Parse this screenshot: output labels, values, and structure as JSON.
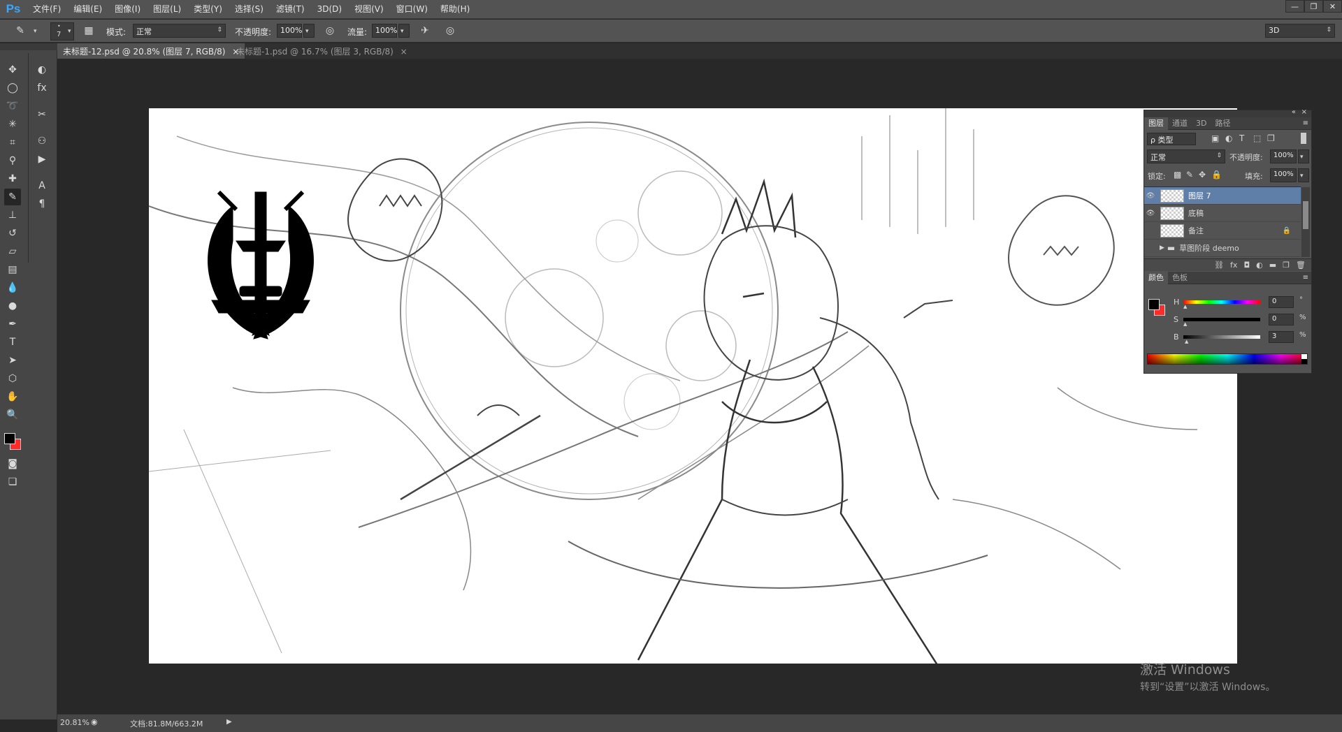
{
  "app": {
    "logo": "Ps"
  },
  "menu": [
    "文件(F)",
    "编辑(E)",
    "图像(I)",
    "图层(L)",
    "类型(Y)",
    "选择(S)",
    "滤镜(T)",
    "3D(D)",
    "视图(V)",
    "窗口(W)",
    "帮助(H)"
  ],
  "window_buttons": [
    "—",
    "❐",
    "✕"
  ],
  "options": {
    "brush_size": "7",
    "mode_label": "模式:",
    "mode_value": "正常",
    "opacity_label": "不透明度:",
    "opacity_value": "100%",
    "flow_label": "流量:",
    "flow_value": "100%",
    "workspace": "3D"
  },
  "tabs": [
    {
      "label": "未标题-12.psd @ 20.8% (图层 7, RGB/8)",
      "close": "×"
    },
    {
      "label": "未标题-1.psd @ 16.7% (图层 3, RGB/8)",
      "close": "×"
    }
  ],
  "layers_panel": {
    "tabs": [
      "图层",
      "通道",
      "3D",
      "路径"
    ],
    "filter_label": "ρ 类型",
    "blend_mode": "正常",
    "opacity_label": "不透明度:",
    "opacity_value": "100%",
    "lock_label": "锁定:",
    "fill_label": "填充:",
    "fill_value": "100%",
    "layers": [
      {
        "name": "图层 7",
        "visible": true,
        "selected": true
      },
      {
        "name": "底稿",
        "visible": true,
        "selected": false
      },
      {
        "name": "备注",
        "visible": false,
        "selected": false,
        "locked": true
      },
      {
        "name": "草图阶段 deemo",
        "visible": false,
        "selected": false,
        "group": true
      }
    ]
  },
  "color_panel": {
    "tabs": [
      "颜色",
      "色板"
    ],
    "sliders": [
      {
        "label": "H",
        "value": "0",
        "unit": "°"
      },
      {
        "label": "S",
        "value": "0",
        "unit": "%"
      },
      {
        "label": "B",
        "value": "3",
        "unit": "%"
      }
    ],
    "foreground": "#000000",
    "background": "#ff2a2a"
  },
  "status": {
    "zoom": "20.81%",
    "doc": "文档:81.8M/663.2M"
  },
  "watermark": {
    "title": "激活 Windows",
    "subtitle": "转到“设置”以激活 Windows。"
  },
  "colors": {
    "accent": "#35a8ff",
    "panel": "#535353",
    "selected_layer": "#5f7ea8"
  }
}
